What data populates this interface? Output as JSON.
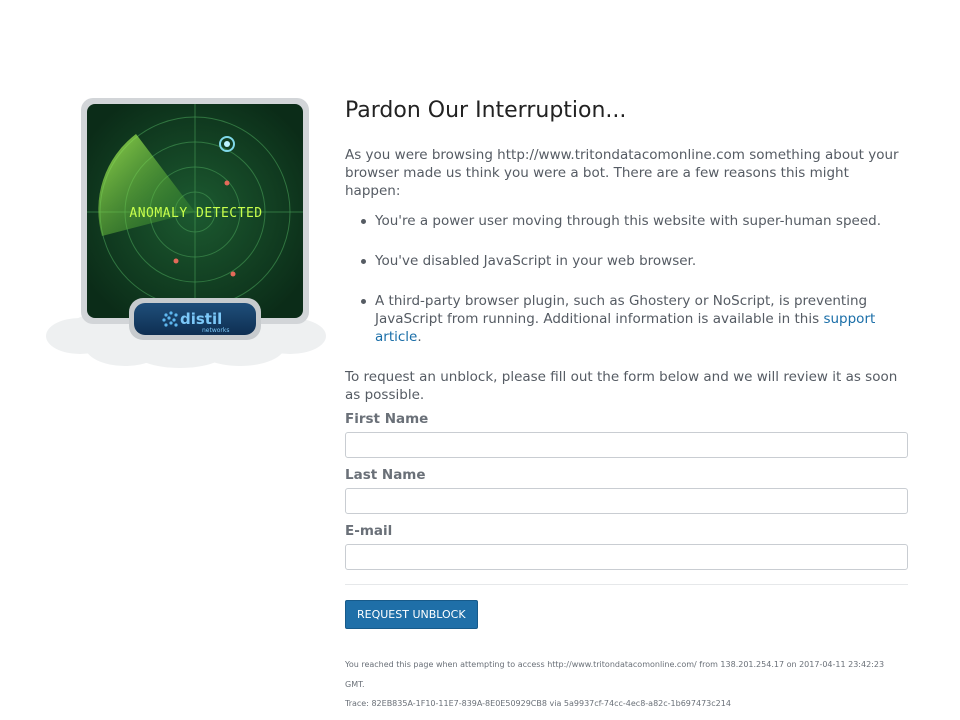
{
  "graphic": {
    "radar_text": "ANOMALY DETECTED",
    "brand_name": "distil",
    "brand_sub": "networks"
  },
  "main": {
    "title": "Pardon Our Interruption...",
    "intro": "As you were browsing http://www.tritondatacomonline.com something about your browser made us think you were a bot. There are a few reasons this might happen:",
    "reasons": [
      "You're a power user moving through this website with super-human speed.",
      "You've disabled JavaScript in your web browser."
    ],
    "reason3_prefix": "A third-party browser plugin, such as Ghostery or NoScript, is preventing JavaScript from running. Additional information is available in this ",
    "reason3_link": "support article",
    "reason3_suffix": ".",
    "request_text": "To request an unblock, please fill out the form below and we will review it as soon as possible."
  },
  "form": {
    "first_name_label": "First Name",
    "first_name_value": "",
    "last_name_label": "Last Name",
    "last_name_value": "",
    "email_label": "E-mail",
    "email_value": "",
    "submit_label": "REQUEST UNBLOCK"
  },
  "footer": {
    "access_line": "You reached this page when attempting to access http://www.tritondatacomonline.com/ from 138.201.254.17 on 2017-04-11 23:42:23 GMT.",
    "trace_line": "Trace: 82EB835A-1F10-11E7-839A-8E0E50929CB8 via 5a9937cf-74cc-4ec8-a82c-1b697473c214"
  },
  "colors": {
    "accent": "#1f6fa8",
    "link": "#1a6ea8",
    "radar_green": "#8ef04a",
    "radar_bg": "#0f3a22"
  }
}
